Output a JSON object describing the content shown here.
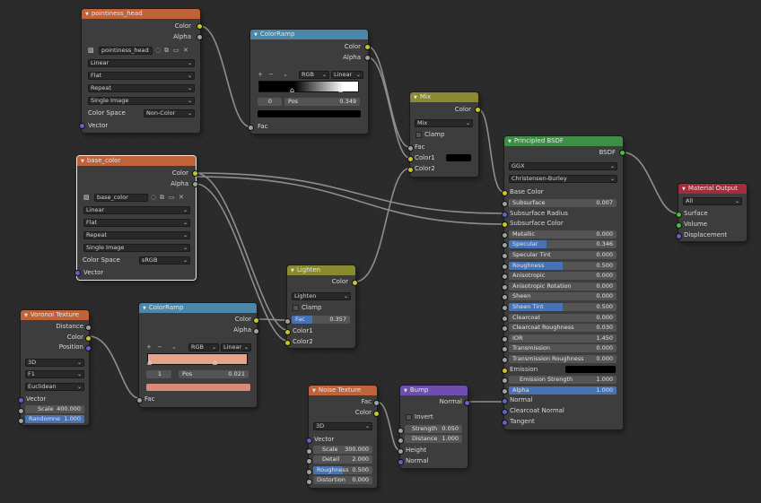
{
  "nodes": {
    "image1": {
      "title": "pointiness_head",
      "outputs": [
        "Color",
        "Alpha"
      ],
      "image_name": "pointiness_head",
      "dropdowns": [
        "Linear",
        "Flat",
        "Repeat",
        "Single Image"
      ],
      "color_space_label": "Color Space",
      "color_space_value": "Non-Color",
      "input": "Vector"
    },
    "image2": {
      "title": "base_color",
      "outputs": [
        "Color",
        "Alpha"
      ],
      "image_name": "base_color",
      "dropdowns": [
        "Linear",
        "Flat",
        "Repeat",
        "Single Image"
      ],
      "color_space_label": "Color Space",
      "color_space_value": "sRGB",
      "input": "Vector"
    },
    "ramp1": {
      "title": "ColorRamp",
      "outputs": [
        "Color",
        "Alpha"
      ],
      "mode": "RGB",
      "interp": "Linear",
      "index": "0",
      "pos_label": "Pos",
      "pos_value": "0.349",
      "input": "Fac"
    },
    "ramp2": {
      "title": "ColorRamp",
      "outputs": [
        "Color",
        "Alpha"
      ],
      "mode": "RGB",
      "interp": "Linear",
      "index": "1",
      "pos_label": "Pos",
      "pos_value": "0.021",
      "input": "Fac"
    },
    "mix": {
      "title": "Mix",
      "output": "Color",
      "blend": "Mix",
      "clamp": "Clamp",
      "inputs": [
        "Fac",
        "Color1",
        "Color2"
      ]
    },
    "lighten": {
      "title": "Lighten",
      "output": "Color",
      "blend": "Lighten",
      "clamp": "Clamp",
      "fac_label": "Fac",
      "fac_value": "0.357",
      "inputs": [
        "Color1",
        "Color2"
      ]
    },
    "voronoi": {
      "title": "Voronoi Texture",
      "outputs": [
        "Distance",
        "Color",
        "Position"
      ],
      "dropdowns": [
        "3D",
        "F1",
        "Euclidean"
      ],
      "vector": "Vector",
      "scale_label": "Scale",
      "scale_value": "400.000",
      "random_label": "Randomne",
      "random_value": "1.000"
    },
    "noise": {
      "title": "Noise Texture",
      "outputs": [
        "Fac",
        "Color"
      ],
      "dim": "3D",
      "vector": "Vector",
      "fields": [
        {
          "label": "Scale",
          "value": "300.000"
        },
        {
          "label": "Detail",
          "value": "2.000"
        },
        {
          "label": "Roughness",
          "value": "0.500"
        },
        {
          "label": "Distortion",
          "value": "0.000"
        }
      ]
    },
    "bump": {
      "title": "Bump",
      "output": "Normal",
      "invert": "Invert",
      "fields": [
        {
          "label": "Strength",
          "value": "0.050"
        },
        {
          "label": "Distance",
          "value": "1.000"
        }
      ],
      "inputs": [
        "Height",
        "Normal"
      ]
    },
    "bsdf": {
      "title": "Principled BSDF",
      "output": "BSDF",
      "distribution": "GGX",
      "subsurface_method": "Christensen-Burley",
      "base_color": "Base Color",
      "rows": [
        {
          "label": "Subsurface",
          "value": "0.007"
        },
        {
          "label": "Subsurface Radius",
          "value": ""
        },
        {
          "label": "Subsurface Color",
          "value": ""
        },
        {
          "label": "Metallic",
          "value": "0.000"
        },
        {
          "label": "Specular",
          "value": "0.346"
        },
        {
          "label": "Specular Tint",
          "value": "0.000"
        },
        {
          "label": "Roughness",
          "value": "0.500"
        },
        {
          "label": "Anisotropic",
          "value": "0.000"
        },
        {
          "label": "Anisotropic Rotation",
          "value": "0.000"
        },
        {
          "label": "Sheen",
          "value": "0.000"
        },
        {
          "label": "Sheen Tint",
          "value": "0.500"
        },
        {
          "label": "Clearcoat",
          "value": "0.000"
        },
        {
          "label": "Clearcoat Roughness",
          "value": "0.030"
        },
        {
          "label": "IOR",
          "value": "1.450"
        },
        {
          "label": "Transmission",
          "value": "0.000"
        },
        {
          "label": "Transmission Roughness",
          "value": "0.000"
        },
        {
          "label": "Emission",
          "value": ""
        },
        {
          "label": "Emission Strength",
          "value": "1.000"
        },
        {
          "label": "Alpha",
          "value": "1.000"
        },
        {
          "label": "Normal",
          "value": ""
        },
        {
          "label": "Clearcoat Normal",
          "value": ""
        },
        {
          "label": "Tangent",
          "value": ""
        }
      ]
    },
    "output": {
      "title": "Material Output",
      "target": "All",
      "inputs": [
        "Surface",
        "Volume",
        "Displacement"
      ]
    }
  },
  "colors": {
    "texture_header": "#c0633a",
    "converter_header": "#4b87a8",
    "color_header": "#8a8a2e",
    "shader_header": "#3f8e47",
    "output_header": "#a52d3b",
    "vector_header": "#6e4fb0",
    "value_fill": "#4772b3"
  }
}
